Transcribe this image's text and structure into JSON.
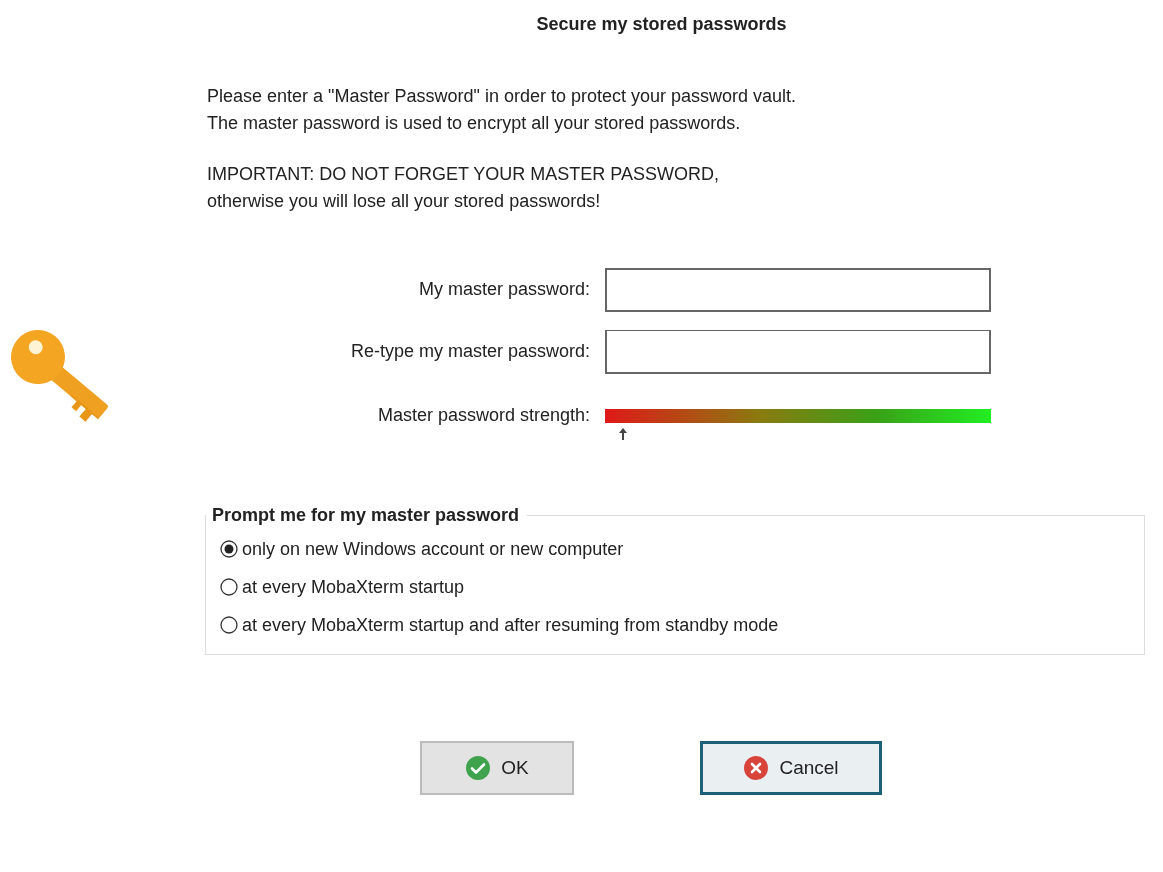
{
  "title": "Secure my stored passwords",
  "intro": [
    "Please enter a \"Master Password\" in order to protect your password vault.\nThe master password is used to encrypt all your stored passwords.",
    "IMPORTANT:  DO NOT FORGET YOUR MASTER PASSWORD,\notherwise you will lose all your stored passwords!"
  ],
  "fields": [
    {
      "label": "My master password:"
    },
    {
      "label": "Re-type my master password:"
    }
  ],
  "strength": {
    "label": "Master password strength:",
    "level": 0.04
  },
  "prompt_group": {
    "title": "Prompt me for my master password",
    "options": [
      {
        "label": "only on new Windows account or new computer",
        "selected": true
      },
      {
        "label": "at every MobaXterm startup",
        "selected": false
      },
      {
        "label": "at every MobaXterm startup and after resuming from standby mode",
        "selected": false
      }
    ]
  },
  "buttons": [
    {
      "kind": "ok",
      "label": "OK",
      "focused": false
    },
    {
      "kind": "cancel",
      "label": "Cancel",
      "focused": true
    }
  ]
}
